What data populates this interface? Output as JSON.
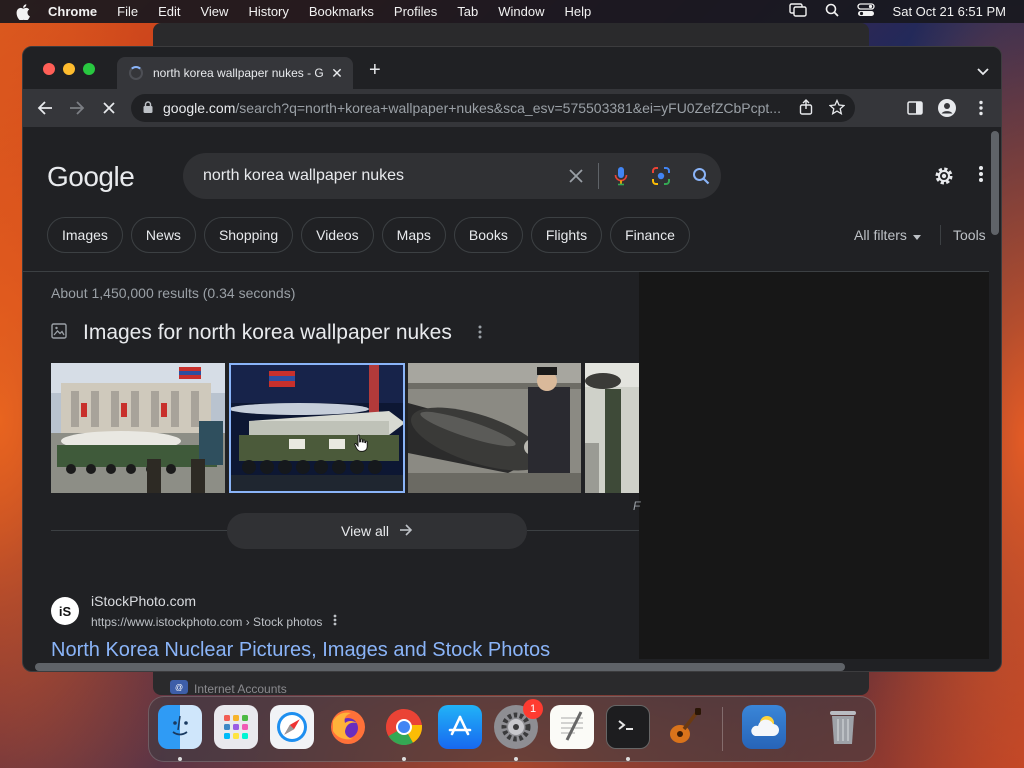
{
  "menubar": {
    "items": [
      "Chrome",
      "File",
      "Edit",
      "View",
      "History",
      "Bookmarks",
      "Profiles",
      "Tab",
      "Window",
      "Help"
    ],
    "clock": "Sat Oct 21  6:51 PM"
  },
  "background_window": {
    "label": "Internet Accounts"
  },
  "browser": {
    "tab_title": "north korea wallpaper nukes - G",
    "url_domain": "google.com",
    "url_path": "/search?q=north+korea+wallpaper+nukes&sca_esv=575503381&ei=yFU0ZefZCbPcpt..."
  },
  "google": {
    "logo": "Google",
    "query": "north korea wallpaper nukes",
    "chips": [
      "Images",
      "News",
      "Shopping",
      "Videos",
      "Maps",
      "Books",
      "Flights",
      "Finance"
    ],
    "all_filters": "All filters",
    "tools": "Tools",
    "result_stats": "About 1,450,000 results (0.34 seconds)",
    "images_heading": "Images for north korea wallpaper nukes",
    "view_all": "View all",
    "edge_letter": "F",
    "results": [
      {
        "favicon": "iS",
        "site_name": "iStockPhoto.com",
        "site_url": "https://www.istockphoto.com › Stock photos",
        "title": "North Korea Nuclear Pictures, Images and Stock Photos"
      }
    ]
  },
  "dock": {
    "apps": [
      "finder-icon",
      "launchpad-icon",
      "safari-icon",
      "firefox-icon",
      "chrome-icon",
      "app-store-icon",
      "system-settings-icon",
      "textedit-icon",
      "terminal-icon",
      "garageband-icon",
      "weather-icon",
      "trash-icon"
    ],
    "settings_badge": "1",
    "colors": {
      "firefox": "#ff7139",
      "chrome_red": "#ea4335",
      "chrome_yellow": "#fbbc05",
      "chrome_green": "#34a853",
      "chrome_blue": "#4285f4",
      "link": "#8ab4f8"
    }
  }
}
